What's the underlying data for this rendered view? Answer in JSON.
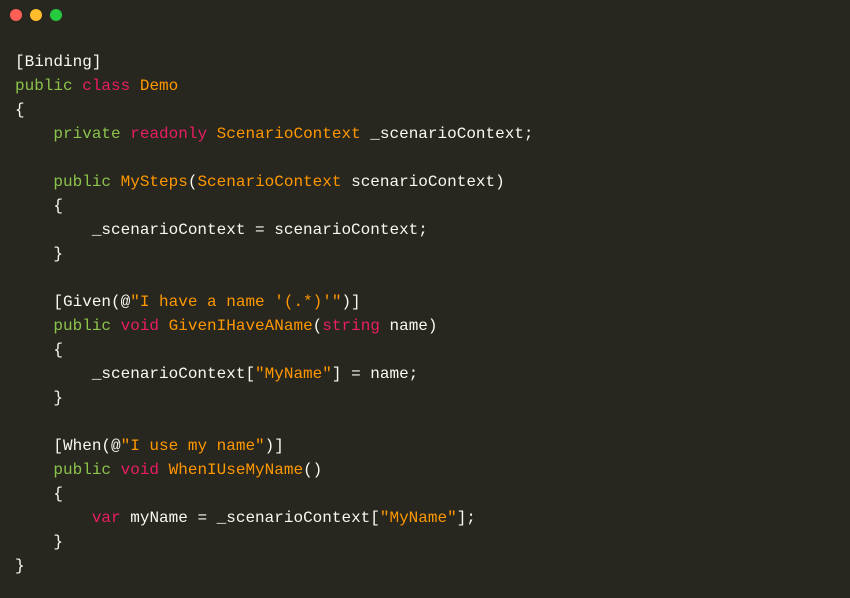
{
  "code": {
    "l1": "[Binding]",
    "l2_kw1": "public",
    "l2_kw2": "class",
    "l2_name": "Demo",
    "l3": "{",
    "l4_kw1": "private",
    "l4_kw2": "readonly",
    "l4_type": "ScenarioContext",
    "l4_field": "_scenarioContext;",
    "l5_kw": "public",
    "l5_method": "MySteps",
    "l5_paramtype": "ScenarioContext",
    "l5_paramname": "scenarioContext)",
    "l6": "    {",
    "l7": "        _scenarioContext = scenarioContext;",
    "l8": "    }",
    "l9_a": "    [Given(@",
    "l9_str": "\"I have a name '(.*)'\"",
    "l9_b": ")]",
    "l10_kw1": "public",
    "l10_kw2": "void",
    "l10_method": "GivenIHaveAName",
    "l10_paramtype": "string",
    "l10_paramname": "name)",
    "l11": "    {",
    "l12_a": "        _scenarioContext[",
    "l12_str": "\"MyName\"",
    "l12_b": "] = name;",
    "l13": "    }",
    "l14_a": "    [When(@",
    "l14_str": "\"I use my name\"",
    "l14_b": ")]",
    "l15_kw1": "public",
    "l15_kw2": "void",
    "l15_method": "WhenIUseMyName",
    "l15_end": "()",
    "l16": "    {",
    "l17_kw": "var",
    "l17_a": "myName = _scenarioContext[",
    "l17_str": "\"MyName\"",
    "l17_b": "];",
    "l18": "    }",
    "l19": "}"
  }
}
